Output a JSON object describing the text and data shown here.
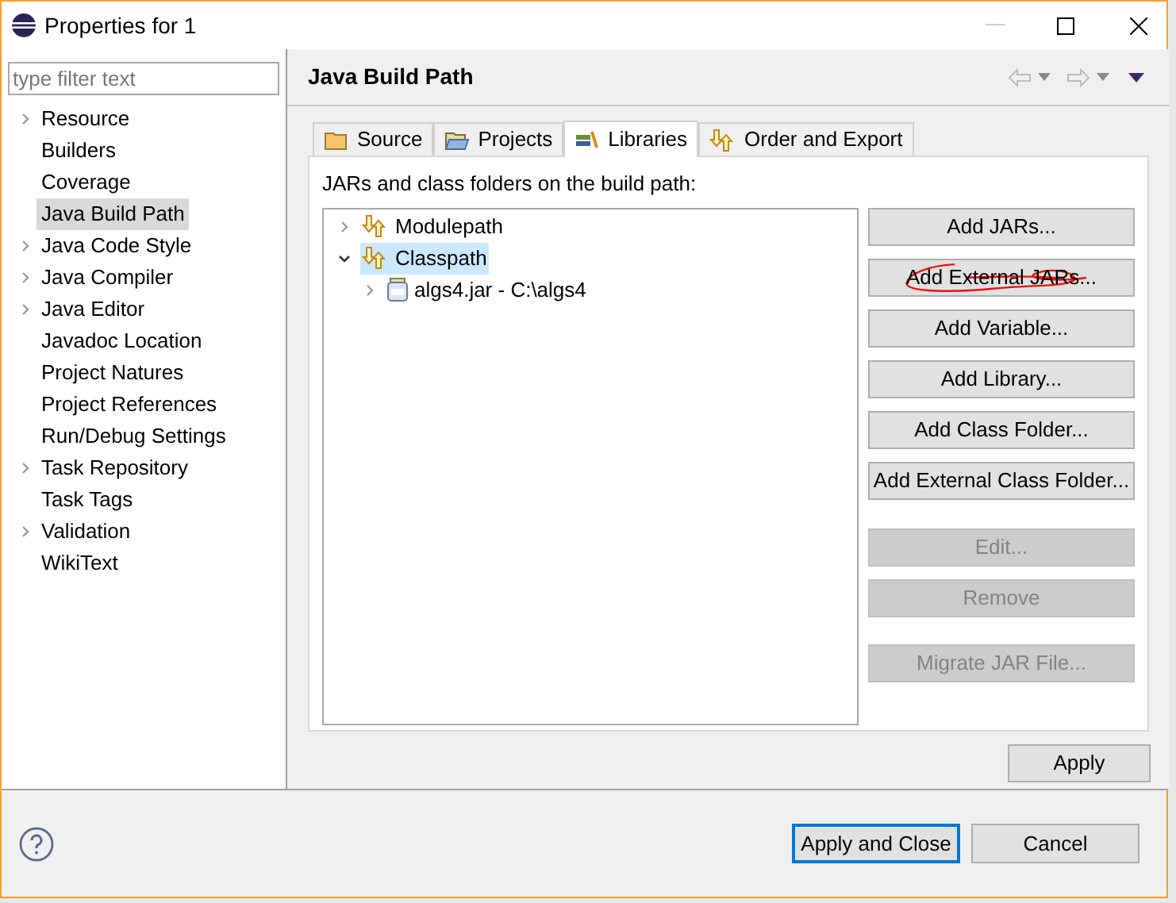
{
  "window": {
    "title": "Properties for 1"
  },
  "filter": {
    "placeholder": "type filter text"
  },
  "nav": [
    {
      "label": "Resource",
      "expandable": true,
      "selected": false
    },
    {
      "label": "Builders",
      "expandable": false,
      "selected": false
    },
    {
      "label": "Coverage",
      "expandable": false,
      "selected": false
    },
    {
      "label": "Java Build Path",
      "expandable": false,
      "selected": true
    },
    {
      "label": "Java Code Style",
      "expandable": true,
      "selected": false
    },
    {
      "label": "Java Compiler",
      "expandable": true,
      "selected": false
    },
    {
      "label": "Java Editor",
      "expandable": true,
      "selected": false
    },
    {
      "label": "Javadoc Location",
      "expandable": false,
      "selected": false
    },
    {
      "label": "Project Natures",
      "expandable": false,
      "selected": false
    },
    {
      "label": "Project References",
      "expandable": false,
      "selected": false
    },
    {
      "label": "Run/Debug Settings",
      "expandable": false,
      "selected": false
    },
    {
      "label": "Task Repository",
      "expandable": true,
      "selected": false
    },
    {
      "label": "Task Tags",
      "expandable": false,
      "selected": false
    },
    {
      "label": "Validation",
      "expandable": true,
      "selected": false
    },
    {
      "label": "WikiText",
      "expandable": false,
      "selected": false
    }
  ],
  "page": {
    "title": "Java Build Path"
  },
  "tabs": [
    {
      "label": "Source",
      "kind": "source",
      "selected": false
    },
    {
      "label": "Projects",
      "kind": "projects",
      "selected": false
    },
    {
      "label": "Libraries",
      "kind": "libraries",
      "selected": true
    },
    {
      "label": "Order and Export",
      "kind": "order",
      "selected": false
    }
  ],
  "description": "JARs and class folders on the build path:",
  "tree": [
    {
      "label": "Modulepath",
      "kind": "path",
      "expanded": false,
      "selected": false
    },
    {
      "label": "Classpath",
      "kind": "path",
      "expanded": true,
      "selected": true,
      "children": [
        {
          "label": "algs4.jar - C:\\algs4",
          "kind": "jar",
          "expanded": false,
          "selected": false
        }
      ]
    }
  ],
  "button_groups": [
    [
      {
        "label": "Add JARs...",
        "disabled": false,
        "annotated": false
      },
      {
        "label": "Add External JARs...",
        "disabled": false,
        "annotated": true
      },
      {
        "label": "Add Variable...",
        "disabled": false,
        "annotated": false
      },
      {
        "label": "Add Library...",
        "disabled": false,
        "annotated": false
      },
      {
        "label": "Add Class Folder...",
        "disabled": false,
        "annotated": false
      },
      {
        "label": "Add External Class Folder...",
        "disabled": false,
        "annotated": false
      }
    ],
    [
      {
        "label": "Edit...",
        "disabled": true,
        "annotated": false
      },
      {
        "label": "Remove",
        "disabled": true,
        "annotated": false
      }
    ],
    [
      {
        "label": "Migrate JAR File...",
        "disabled": true,
        "annotated": false
      }
    ]
  ],
  "apply": "Apply",
  "footer": [
    {
      "label": "Apply and Close",
      "default": true
    },
    {
      "label": "Cancel",
      "default": false
    }
  ]
}
